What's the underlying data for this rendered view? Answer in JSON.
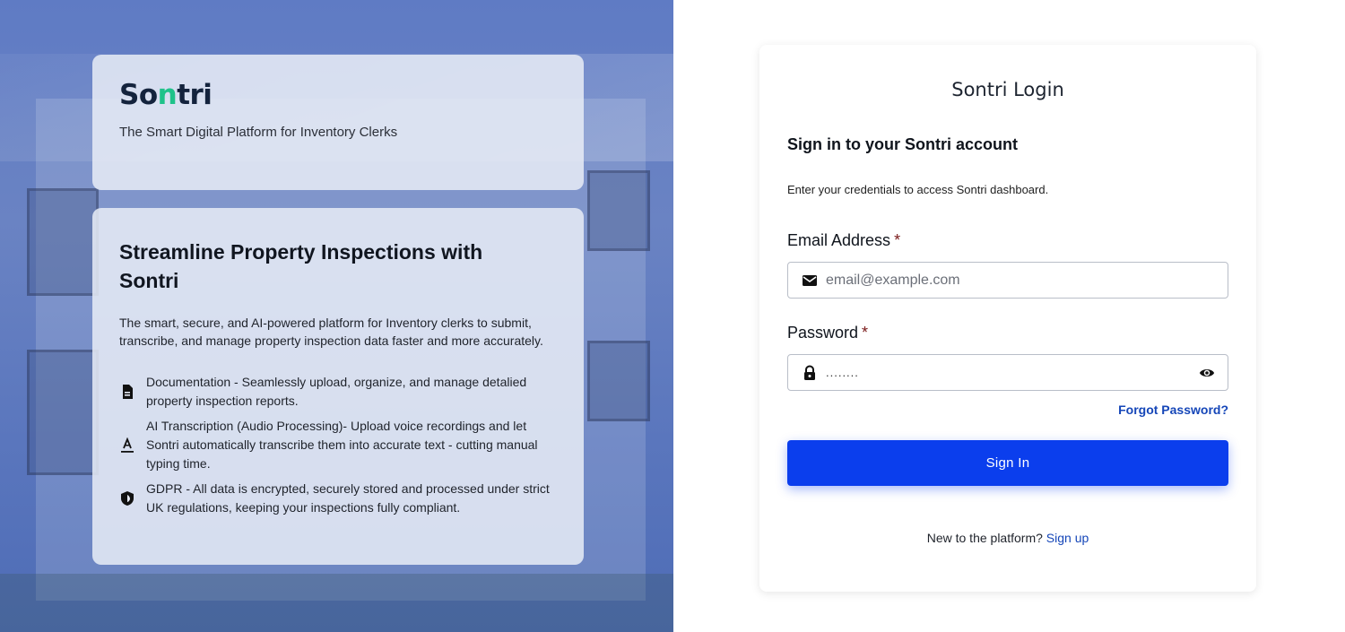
{
  "brand": {
    "logo_pre": "So",
    "logo_n": "n",
    "logo_post": "tri",
    "tagline": "The Smart Digital Platform for Inventory Clerks"
  },
  "hero": {
    "title": "Streamline Property Inspections with Sontri",
    "description": "The smart, secure, and AI-powered platform for Inventory clerks to submit, transcribe, and manage property inspection data faster and more accurately.",
    "features": [
      {
        "icon": "document-icon",
        "text": "Documentation - Seamlessly upload, organize, and manage detalied property inspection reports."
      },
      {
        "icon": "text-format-icon",
        "text": "AI Transcription (Audio Processing)- Upload voice recordings and let Sontri automatically transcribe them into accurate text - cutting manual typing time."
      },
      {
        "icon": "shield-icon",
        "text": "GDPR - All data is encrypted, securely stored and processed under strict UK regulations, keeping your inspections fully compliant."
      }
    ]
  },
  "login": {
    "title": "Sontri Login",
    "heading": "Sign in to your Sontri account",
    "subheading": "Enter your credentials to access Sontri dashboard.",
    "email_label": "Email Address",
    "email_placeholder": "email@example.com",
    "password_label": "Password",
    "password_value": "........",
    "required_mark": "*",
    "forgot_label": "Forgot Password?",
    "signin_label": "Sign In",
    "signup_prompt": "New to the platform?",
    "signup_link": "Sign up"
  },
  "colors": {
    "primary_button": "#0b3eed",
    "link": "#1546b8",
    "logo_accent": "#1fc28a"
  }
}
